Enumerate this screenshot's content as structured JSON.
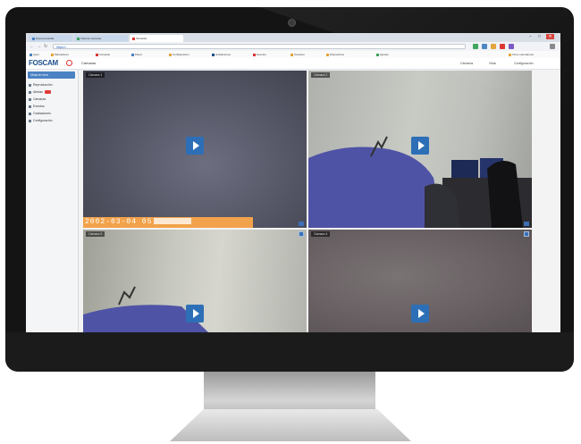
{
  "browser": {
    "tabs": [
      {
        "label": "Nueva pestaña",
        "color": "#c9d7ea"
      },
      {
        "label": "Vista de cámaras",
        "color": "#c9d7ea"
      },
      {
        "label": "Cámaras",
        "color": "#ffffff"
      }
    ],
    "window_controls": [
      "–",
      "□",
      "✕"
    ],
    "nav": [
      "←",
      "→",
      "↻"
    ],
    "url": "https://...",
    "bookmarks": [
      "Apps",
      "Marcadores",
      "Cámaras",
      "Panel",
      "Configuración",
      "Grabaciones",
      "Eventos",
      "Usuarios",
      "Dispositivos",
      "Ajustes",
      "Otros marcadores"
    ]
  },
  "app": {
    "logo": "FOSCAM",
    "section_title": "Cámaras",
    "header_items": [
      "Cámaras",
      "Vista",
      "Configuración"
    ],
    "sidebar": {
      "active": "Vista en vivo",
      "items": [
        {
          "label": "Reproducción",
          "badge": false
        },
        {
          "label": "Alertas",
          "badge": true
        },
        {
          "label": "Cámaras",
          "badge": false
        },
        {
          "label": "Eventos",
          "badge": false
        },
        {
          "label": "Grabaciones",
          "badge": false
        },
        {
          "label": "Configuración",
          "badge": false
        }
      ]
    },
    "tiles": [
      {
        "name": "cam-1",
        "label": "Cámara 1",
        "has_timeline": true,
        "timeline": "2002-03-04 05"
      },
      {
        "name": "cam-2",
        "label": "Cámara 2",
        "has_timeline": false
      },
      {
        "name": "cam-3",
        "label": "Cámara 3",
        "has_timeline": false
      },
      {
        "name": "cam-4",
        "label": "Cámara 4",
        "has_timeline": false
      }
    ]
  },
  "colors": {
    "accent": "#2d6fb7",
    "timeline": "#f2a24a",
    "alert_badge": "#e13b3b"
  }
}
